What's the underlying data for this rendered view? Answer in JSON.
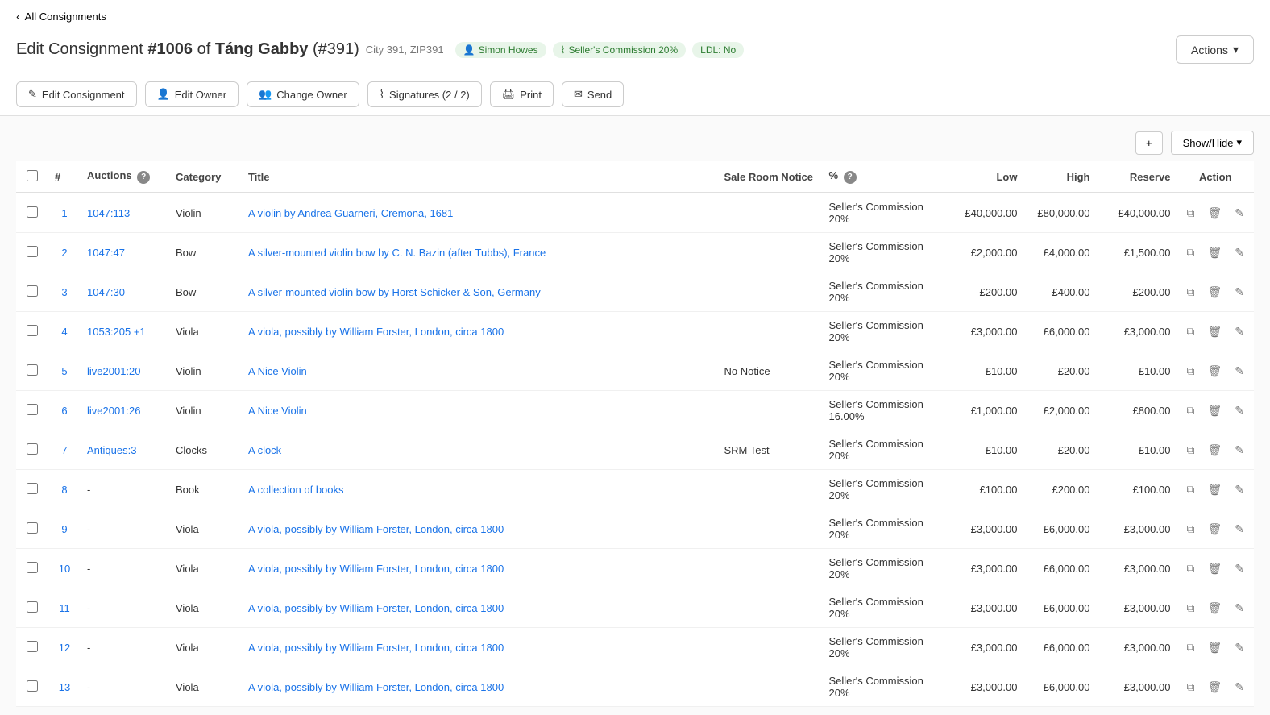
{
  "nav": {
    "back_label": "All Consignments"
  },
  "header": {
    "title_prefix": "Edit Consignment ",
    "consignment_number": "#1006",
    "title_middle": " of ",
    "owner_name": "Táng Gabby",
    "owner_id": "(#391)",
    "location": "City 391, ZIP391",
    "badges": [
      {
        "icon": "user",
        "label": "Simon Howes"
      },
      {
        "icon": "percent",
        "label": "Seller's Commission 20%"
      },
      {
        "label": "LDL: No"
      }
    ]
  },
  "actions_button": "Actions",
  "toolbar": {
    "buttons": [
      {
        "key": "edit-consignment",
        "label": "Edit Consignment",
        "icon": "edit"
      },
      {
        "key": "edit-owner",
        "label": "Edit Owner",
        "icon": "person"
      },
      {
        "key": "change-owner",
        "label": "Change Owner",
        "icon": "people"
      },
      {
        "key": "signatures",
        "label": "Signatures (2 / 2)",
        "icon": "signature"
      },
      {
        "key": "print",
        "label": "Print",
        "icon": "print"
      },
      {
        "key": "send",
        "label": "Send",
        "icon": "send"
      }
    ]
  },
  "table": {
    "add_button": "+",
    "show_hide_button": "Show/Hide",
    "columns": [
      "#",
      "Auctions",
      "Category",
      "Title",
      "Sale Room Notice",
      "%",
      "Low",
      "High",
      "Reserve",
      "Action"
    ],
    "rows": [
      {
        "num": "1",
        "auctions": "1047:113",
        "category": "Violin",
        "title": "A violin by Andrea Guarneri, Cremona, 1681",
        "srn": "",
        "pct": "Seller's Commission 20%",
        "low": "£40,000.00",
        "high": "£80,000.00",
        "reserve": "£40,000.00"
      },
      {
        "num": "2",
        "auctions": "1047:47",
        "category": "Bow",
        "title": "A silver-mounted violin bow by C. N. Bazin (after Tubbs), France",
        "srn": "",
        "pct": "Seller's Commission 20%",
        "low": "£2,000.00",
        "high": "£4,000.00",
        "reserve": "£1,500.00"
      },
      {
        "num": "3",
        "auctions": "1047:30",
        "category": "Bow",
        "title": "A silver-mounted violin bow by Horst Schicker & Son, Germany",
        "srn": "",
        "pct": "Seller's Commission 20%",
        "low": "£200.00",
        "high": "£400.00",
        "reserve": "£200.00"
      },
      {
        "num": "4",
        "auctions": "1053:205 +1",
        "category": "Viola",
        "title": "A viola, possibly by William Forster, London, circa 1800",
        "srn": "",
        "pct": "Seller's Commission 20%",
        "low": "£3,000.00",
        "high": "£6,000.00",
        "reserve": "£3,000.00"
      },
      {
        "num": "5",
        "auctions": "live2001:20",
        "category": "Violin",
        "title": "A Nice Violin",
        "srn": "No Notice",
        "pct": "Seller's Commission 20%",
        "low": "£10.00",
        "high": "£20.00",
        "reserve": "£10.00"
      },
      {
        "num": "6",
        "auctions": "live2001:26",
        "category": "Violin",
        "title": "A Nice Violin",
        "srn": "",
        "pct": "Seller's Commission 16.00%",
        "low": "£1,000.00",
        "high": "£2,000.00",
        "reserve": "£800.00"
      },
      {
        "num": "7",
        "auctions": "Antiques:3",
        "category": "Clocks",
        "title": "A clock",
        "srn": "SRM Test",
        "pct": "Seller's Commission 20%",
        "low": "£10.00",
        "high": "£20.00",
        "reserve": "£10.00"
      },
      {
        "num": "8",
        "auctions": "-",
        "category": "Book",
        "title": "A collection of books",
        "srn": "",
        "pct": "Seller's Commission 20%",
        "low": "£100.00",
        "high": "£200.00",
        "reserve": "£100.00"
      },
      {
        "num": "9",
        "auctions": "-",
        "category": "Viola",
        "title": "A viola, possibly by William Forster, London, circa 1800",
        "srn": "",
        "pct": "Seller's Commission 20%",
        "low": "£3,000.00",
        "high": "£6,000.00",
        "reserve": "£3,000.00"
      },
      {
        "num": "10",
        "auctions": "-",
        "category": "Viola",
        "title": "A viola, possibly by William Forster, London, circa 1800",
        "srn": "",
        "pct": "Seller's Commission 20%",
        "low": "£3,000.00",
        "high": "£6,000.00",
        "reserve": "£3,000.00"
      },
      {
        "num": "11",
        "auctions": "-",
        "category": "Viola",
        "title": "A viola, possibly by William Forster, London, circa 1800",
        "srn": "",
        "pct": "Seller's Commission 20%",
        "low": "£3,000.00",
        "high": "£6,000.00",
        "reserve": "£3,000.00"
      },
      {
        "num": "12",
        "auctions": "-",
        "category": "Viola",
        "title": "A viola, possibly by William Forster, London, circa 1800",
        "srn": "",
        "pct": "Seller's Commission 20%",
        "low": "£3,000.00",
        "high": "£6,000.00",
        "reserve": "£3,000.00"
      },
      {
        "num": "13",
        "auctions": "-",
        "category": "Viola",
        "title": "A viola, possibly by William Forster, London, circa 1800",
        "srn": "",
        "pct": "Seller's Commission 20%",
        "low": "£3,000.00",
        "high": "£6,000.00",
        "reserve": "£3,000.00"
      }
    ]
  }
}
